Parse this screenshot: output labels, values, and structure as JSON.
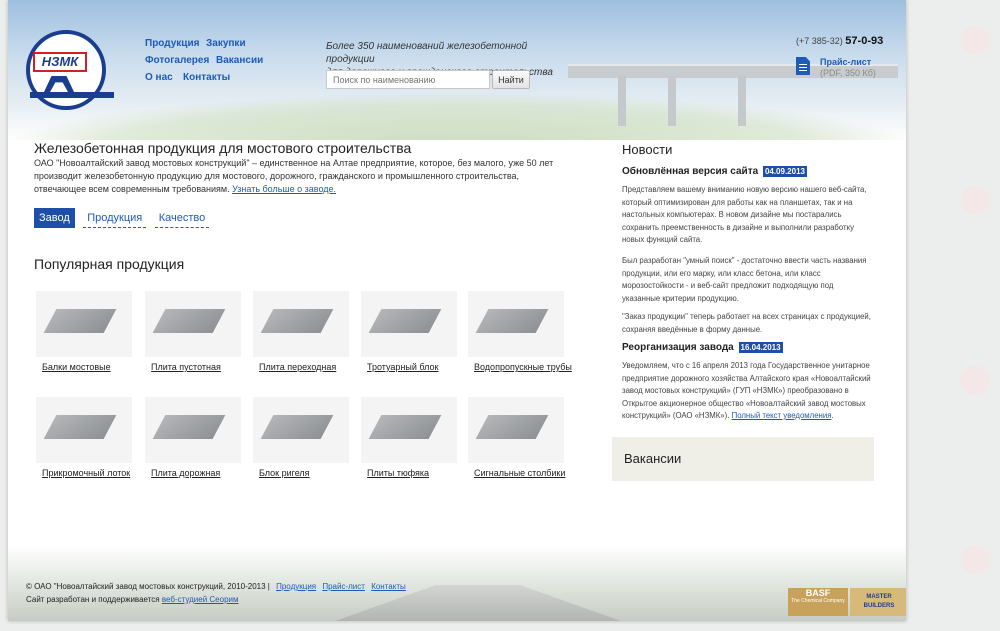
{
  "header": {
    "nav": [
      {
        "label": "Продукция"
      },
      {
        "label": "Закупки"
      },
      {
        "label": "Фотогалерея"
      },
      {
        "label": "Вакансии"
      },
      {
        "label": "О нас"
      },
      {
        "label": "Контакты"
      }
    ],
    "tagline_line1": "Более 350 наименований железобетонной продукции",
    "tagline_line2": "для дорожного и гражданского строительства",
    "search": {
      "placeholder": "Поиск по наименованию",
      "button": "Найти"
    },
    "phone_code": "(+7 385-32)",
    "phone_number": "57-0-93",
    "price_link": "Прайс-лист",
    "price_size": "(PDF, 350 Кб)",
    "logo_text": "НЗМК"
  },
  "main": {
    "title": "Железобетонная продукция для мостового строительства",
    "intro": "ОАО \"Новоалтайский завод мостовых конструкций\" – единственное на Алтае предприятие, которое, без малого, уже 50 лет производит железобетонную продукцию для мостового, дорожного, гражданского и промышленного строительства, отвечающее всем современным требованиям.",
    "intro_link": "Узнать больше о заводе.",
    "tabs": [
      {
        "label": "Завод"
      },
      {
        "label": "Продукция"
      },
      {
        "label": "Качество"
      }
    ],
    "popular_title": "Популярная продукция",
    "products": [
      {
        "label": "Балки мостовые"
      },
      {
        "label": "Плита пустотная"
      },
      {
        "label": "Плита переходная"
      },
      {
        "label": "Тротуарный блок"
      },
      {
        "label": "Водопропускные трубы"
      },
      {
        "label": "Прикромочный лоток"
      },
      {
        "label": "Плита дорожная"
      },
      {
        "label": "Блок ригеля"
      },
      {
        "label": "Плиты тюфяка"
      },
      {
        "label": "Сигнальные столбики"
      }
    ]
  },
  "news": {
    "title": "Новости",
    "items": [
      {
        "heading": "Обновлённая версия сайта",
        "date": "04.09.2013",
        "p1": "Представляем вашему вниманию новую версию нашего веб-сайта, который оптимизирован для работы как на планшетах, так и на настольных компьютерах. В новом дизайне мы постарались сохранить преемственность в дизайне и выполнили разработку новых функций сайта.",
        "p2": "Был разработан \"умный поиск\" - достаточно ввести часть названия продукции, или его марку, или класс бетона, или класс морозостойкости - и веб-сайт предложит подходящую под указанные критерии продукцию.",
        "p3": "\"Заказ продукции\" теперь работает на всех страницах с продукцией, сохраняя введённые в форму данные."
      },
      {
        "heading": "Реорганизация завода",
        "date": "16.04.2013",
        "p1": "Уведомляем, что с 16 апреля 2013 года Государственное унитарное предприятие дорожного хозяйства Алтайского края «Новоалтайский завод мостовых конструкций» (ГУП «НЗМК») преобразовано в Открытое акционерное общество «Новоалтайский завод мостовых конструкций» (ОАО «НЗМК»).",
        "link": "Полный текст уведомления"
      }
    ],
    "vacancies_title": "Вакансии"
  },
  "footer": {
    "copyright": "© ОАО \"Новоалтайский завод мостовых конструкций, 2010-2013 |",
    "links": [
      {
        "label": "Продукция"
      },
      {
        "label": "Прайс-лист"
      },
      {
        "label": "Контакты"
      }
    ],
    "dev_text": "Сайт разработан и поддерживается",
    "dev_link": "веб-студией Сеорим",
    "basf_label": "BASF",
    "basf_sub": "The Chemical Company",
    "mb_line1": "MASTER",
    "mb_line2": "BUILDERS"
  }
}
